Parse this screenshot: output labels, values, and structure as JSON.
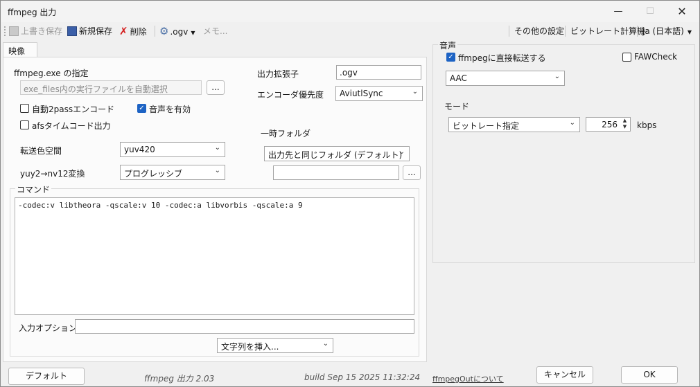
{
  "window": {
    "title": "ffmpeg 出力"
  },
  "toolbar": {
    "overwrite_save": "上書き保存",
    "new_save": "新規保存",
    "delete": "削除",
    "ext": ".ogv",
    "memo": "メモ...",
    "other_settings": "その他の設定",
    "bitrate_calc": "ビットレート計算機",
    "language": "ja (日本語)"
  },
  "tabs": {
    "video": "映像"
  },
  "video": {
    "exe_label": "ffmpeg.exe の指定",
    "exe_placeholder": "exe_files内の実行ファイルを自動選択",
    "browse": "...",
    "auto2pass": "自動2passエンコード",
    "audio_enable": "音声を有効",
    "afs_timecode": "afsタイムコード出力",
    "colorspace_label": "転送色空間",
    "colorspace_value": "yuv420",
    "yuy2_label": "yuy2→nv12変換",
    "yuy2_value": "プログレッシブ",
    "ext_label": "出力拡張子",
    "ext_value": ".ogv",
    "priority_label": "エンコーダ優先度",
    "priority_value": "AviutlSync",
    "tempdir_label": "一時フォルダ",
    "tempdir_value": "出力先と同じフォルダ (デフォルト)",
    "command_label": "コマンド",
    "command_text": "-codec:v libtheora -qscale:v 10 -codec:a libvorbis -qscale:a 9",
    "input_option_label": "入力オプション",
    "insert_string": "文字列を挿入..."
  },
  "audio": {
    "group_label": "音声",
    "ffmpeg_direct": "ffmpegに直接転送する",
    "faw_check": "FAWCheck",
    "codec_value": "AAC",
    "mode_label": "モード",
    "mode_value": "ビットレート指定",
    "bitrate_value": "256",
    "bitrate_unit": "kbps"
  },
  "footer": {
    "default_button": "デフォルト",
    "app_version": "ffmpeg 出力 2.03",
    "build": "build Sep 15 2025 11:32:24",
    "about_link": "ffmpegOutについて",
    "cancel_button": "キャンセル",
    "ok_button": "OK"
  }
}
